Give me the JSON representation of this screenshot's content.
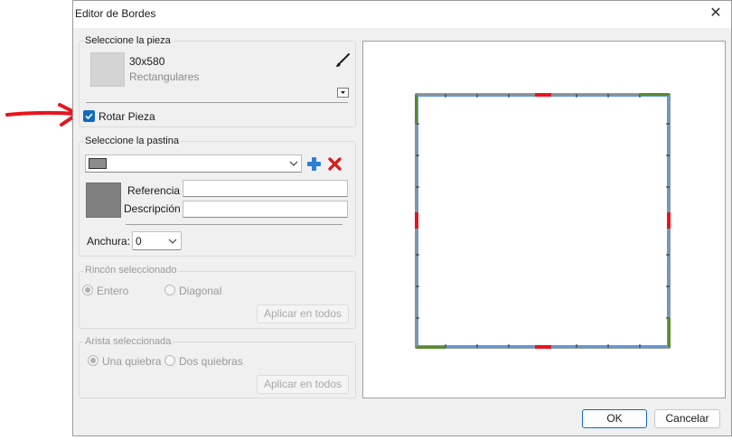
{
  "dialog": {
    "title": "Editor de Bordes",
    "close_icon": "close-icon"
  },
  "piece": {
    "group_label": "Seleccione la pieza",
    "size": "30x580",
    "type": "Rectangulares",
    "brush_icon": "paintbrush-icon",
    "dropdown_icon": "chevron-down-icon"
  },
  "rotate": {
    "label": "Rotar Pieza",
    "checked": true,
    "checkbox_color": "#0f6cbd"
  },
  "paste": {
    "group_label": "Seleccione la pastina",
    "selected_swatch_color": "#8c8c8c",
    "add_icon": "plus-icon",
    "delete_icon": "delete-x-icon",
    "reference_label": "Referencia",
    "reference_value": "",
    "description_label": "Descripción",
    "description_value": "",
    "width_label": "Anchura:",
    "width_value": "0"
  },
  "corner": {
    "group_label": "Rincón seleccionado",
    "option_whole": "Entero",
    "option_diagonal": "Diagonal",
    "selected": "Entero",
    "apply_label": "Aplicar en todos"
  },
  "edge": {
    "group_label": "Arista seleccionada",
    "option_one": "Una quiebra",
    "option_two": "Dos quiebras",
    "selected": "Una quiebra",
    "apply_label": "Aplicar en todos"
  },
  "buttons": {
    "ok": "OK",
    "cancel": "Cancelar"
  },
  "annotation": {
    "arrow_color": "#e8141e"
  },
  "preview": {
    "edge_color": "#5b9bd5",
    "marker_red": "#e8141e",
    "marker_green": "#5a8a2c"
  }
}
